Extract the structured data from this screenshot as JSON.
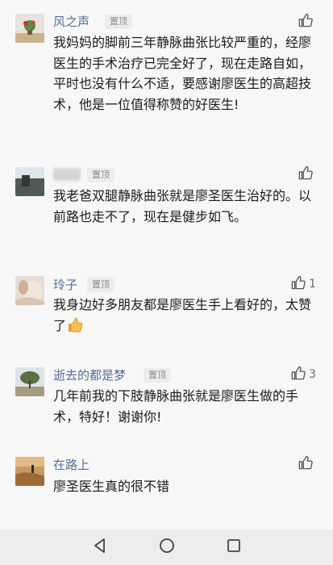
{
  "pin_label": "置顶",
  "comments": [
    {
      "name": "风之声",
      "pinned": true,
      "likes": "",
      "text": "我妈妈的脚前三年静脉曲张比较严重的，经廖医生的手术治疗已完全好了，现在走路自如，平时也没有什么不适，要感谢廖医生的高超技术，他是一位值得称赞的好医生!"
    },
    {
      "name": "",
      "pinned": true,
      "likes": "",
      "text": "我老爸双腿静脉曲张就是廖圣医生治好的。以前路也走不了，现在是健步如飞。"
    },
    {
      "name": "玲子",
      "pinned": true,
      "likes": "1",
      "text": "我身边好多朋友都是廖医生手上看好的，太赞了"
    },
    {
      "name": "逝去的都是梦",
      "pinned": true,
      "likes": "3",
      "text": "几年前我的下肢静脉曲张就是廖医生做的手术，特好！谢谢你!"
    },
    {
      "name": "在路上",
      "pinned": false,
      "likes": "",
      "text": "廖圣医生真的很不错"
    }
  ],
  "icons": {
    "like": "thumbs-up-icon",
    "emoji": "thumbs-up-emoji",
    "nav_back": "back-triangle-icon",
    "nav_home": "home-circle-icon",
    "nav_recent": "recents-square-icon"
  },
  "colors": {
    "name": "#586c94",
    "text": "#1a1a1a",
    "background": "#f7f7f7",
    "pin_bg": "#ececec"
  }
}
